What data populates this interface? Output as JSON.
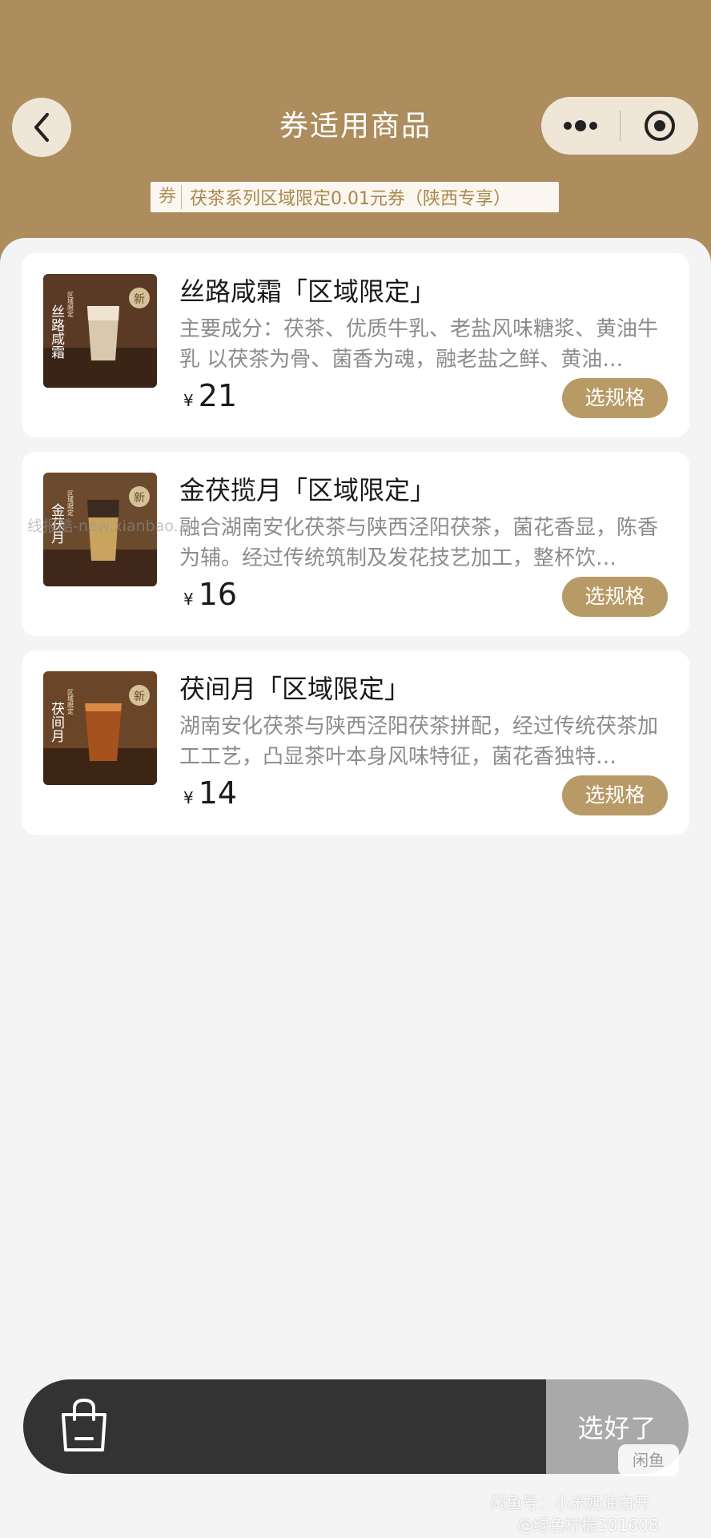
{
  "header": {
    "title": "券适用商品",
    "coupon_tag_label": "券",
    "coupon_text": "茯茶系列区域限定0.01元券（陕西专享）",
    "colors": {
      "background": "#ad8d5e",
      "capsule": "#efe6d8"
    }
  },
  "products": [
    {
      "name": "丝路咸霜「区域限定」",
      "description": "主要成分：茯茶、优质牛乳、老盐风味糖浆、黄油牛乳 以茯茶为骨、菌香为魂，融老盐之鲜、黄油…",
      "currency": "¥",
      "price": "21",
      "button_label": "选规格",
      "thumb_vertical_text": "丝路咸霜",
      "thumb_side_text": "区域限定",
      "thumb_badge": "新"
    },
    {
      "name": "金茯揽月「区域限定」",
      "description": "融合湖南安化茯茶与陕西泾阳茯茶，菌花香显，陈香为辅。经过传统筑制及发花技艺加工，整杯饮…",
      "currency": "¥",
      "price": "16",
      "button_label": "选规格",
      "thumb_vertical_text": "金茯月",
      "thumb_side_text": "区域限定",
      "thumb_badge": "新"
    },
    {
      "name": "茯间月「区域限定」",
      "description": "湖南安化茯茶与陕西泾阳茯茶拼配，经过传统茯茶加工工艺，凸显茶叶本身风味特征，菌花香独特…",
      "currency": "¥",
      "price": "14",
      "button_label": "选规格",
      "thumb_vertical_text": "茯间月",
      "thumb_side_text": "区域限定",
      "thumb_badge": "新"
    }
  ],
  "watermark": "线报酷-new.xianbao...",
  "cart": {
    "icon": "shopping-bag-icon",
    "confirm_label": "选好了"
  },
  "footer": {
    "logo_text": "闲鱼",
    "watermark_line1": "闲鱼号：小米奶油白开",
    "watermark_line2": "@绿色柠檬201608"
  },
  "colors": {
    "accent": "#b89a66",
    "cart_dark": "#333333",
    "cart_button": "#a9a9a9",
    "page_bg": "#f4f4f4"
  }
}
